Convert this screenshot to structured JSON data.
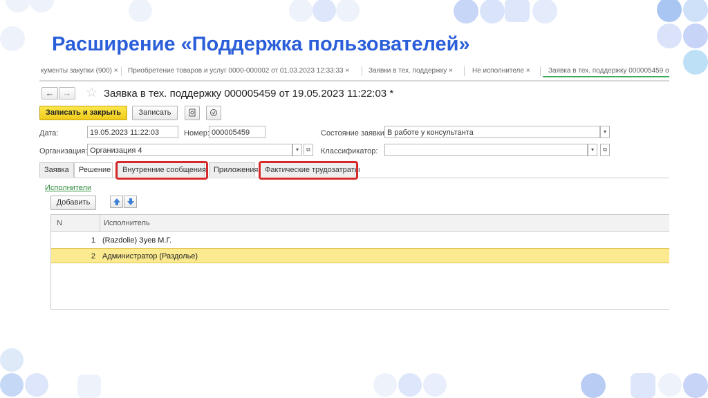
{
  "slide": {
    "title": "Расширение «Поддержка пользователей»"
  },
  "window": {
    "open_tabs": [
      "кументы закупки (900) ×",
      "Приобретение товаров и услуг 0000-000002 от 01.03.2023 12:33:33 ×",
      "Заявки в тех. поддержку ×",
      "Не исполнителе ×",
      "Заявка в тех. поддержку 000005459 от ×"
    ],
    "document_title": "Заявка в тех. поддержку 000005459 от 19.05.2023 11:22:03 *"
  },
  "toolbar": {
    "back_label": "←",
    "forward_label": "→",
    "save_close_label": "Записать и закрыть",
    "save_label": "Записать"
  },
  "form": {
    "date_label": "Дата:",
    "date_value": "19.05.2023 11:22:03",
    "number_label": "Номер:",
    "number_value": "000005459",
    "status_label": "Состояние заявки:",
    "status_value": "В работе у консультанта",
    "org_label": "Организация:",
    "org_value": "Организация 4",
    "classifier_label": "Классификатор:",
    "classifier_value": ""
  },
  "form_tabs": [
    "Заявка",
    "Решение",
    "Внутренние сообщения",
    "Приложения",
    "Фактические трудозатраты"
  ],
  "executors": {
    "link_label": "Исполнители",
    "add_label": "Добавить",
    "columns": [
      "N",
      "Исполнитель"
    ],
    "rows": [
      {
        "n": "1",
        "name": "(Razdolie) Зуев М.Г."
      },
      {
        "n": "2",
        "name": "Администратор (Раздолье)"
      }
    ]
  },
  "colors": {
    "title_blue": "#2b5fd9",
    "highlight_red": "#d62a2a",
    "primary_yellow": "#f5d52d",
    "selected_row": "#fbea90"
  }
}
